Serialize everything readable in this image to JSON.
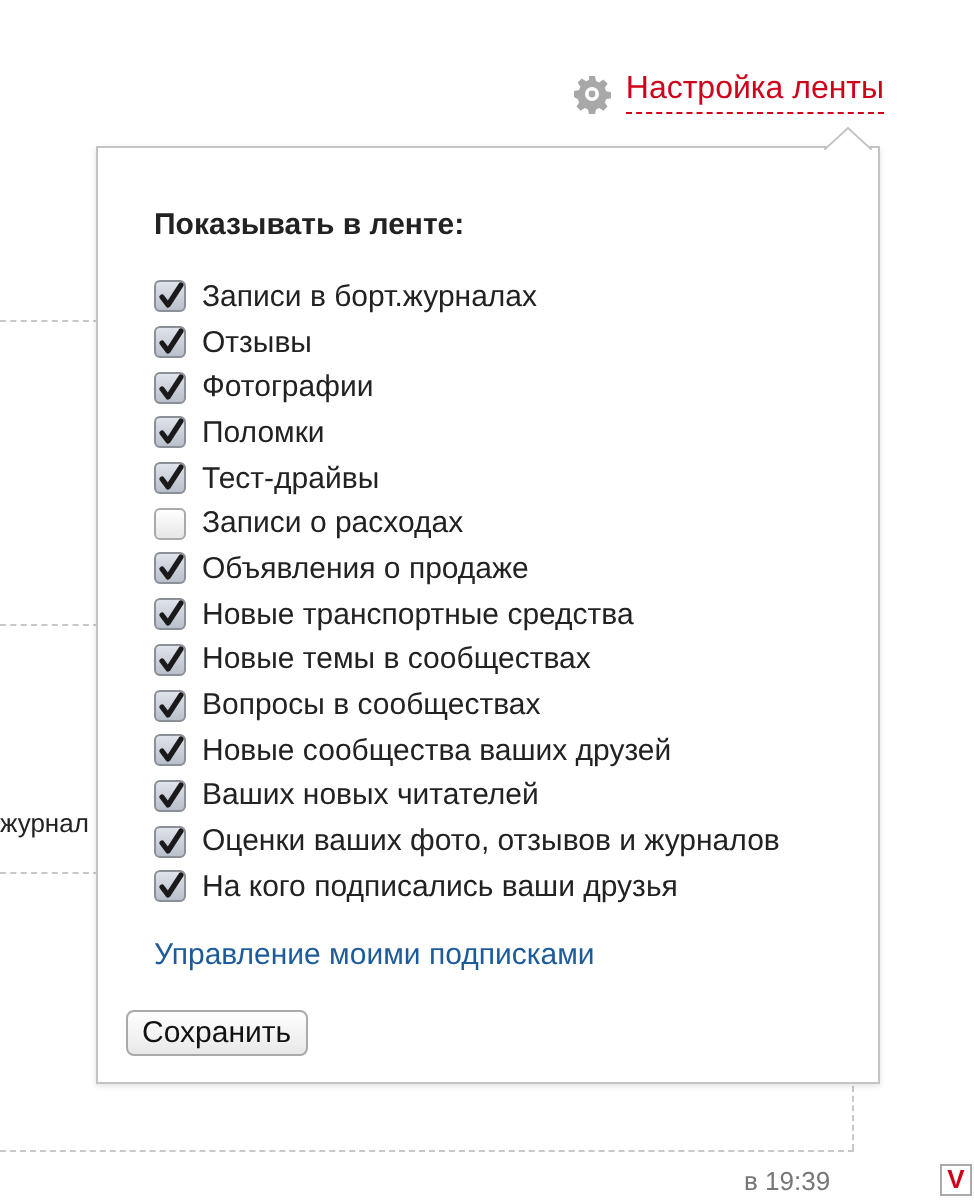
{
  "feed_settings_link": "Настройка ленты",
  "background": {
    "cut_text": "журнал",
    "time": "в 19:39",
    "logo": "V"
  },
  "popup": {
    "heading": "Показывать в ленте:",
    "options": [
      {
        "label": "Записи в борт.журналах",
        "checked": true
      },
      {
        "label": "Отзывы",
        "checked": true
      },
      {
        "label": "Фотографии",
        "checked": true
      },
      {
        "label": "Поломки",
        "checked": true
      },
      {
        "label": "Тест-драйвы",
        "checked": true
      },
      {
        "label": "Записи о расходах",
        "checked": false
      },
      {
        "label": "Объявления о продаже",
        "checked": true
      },
      {
        "label": "Новые транспортные средства",
        "checked": true
      },
      {
        "label": "Новые темы в сообществах",
        "checked": true
      },
      {
        "label": "Вопросы в сообществах",
        "checked": true
      },
      {
        "label": "Новые сообщества ваших друзей",
        "checked": true
      },
      {
        "label": "Ваших новых читателей",
        "checked": true
      },
      {
        "label": "Оценки ваших фото, отзывов и журналов",
        "checked": true
      },
      {
        "label": "На кого подписались ваши друзья",
        "checked": true
      }
    ],
    "manage_link": "Управление моими подписками",
    "save_button": "Сохранить"
  }
}
